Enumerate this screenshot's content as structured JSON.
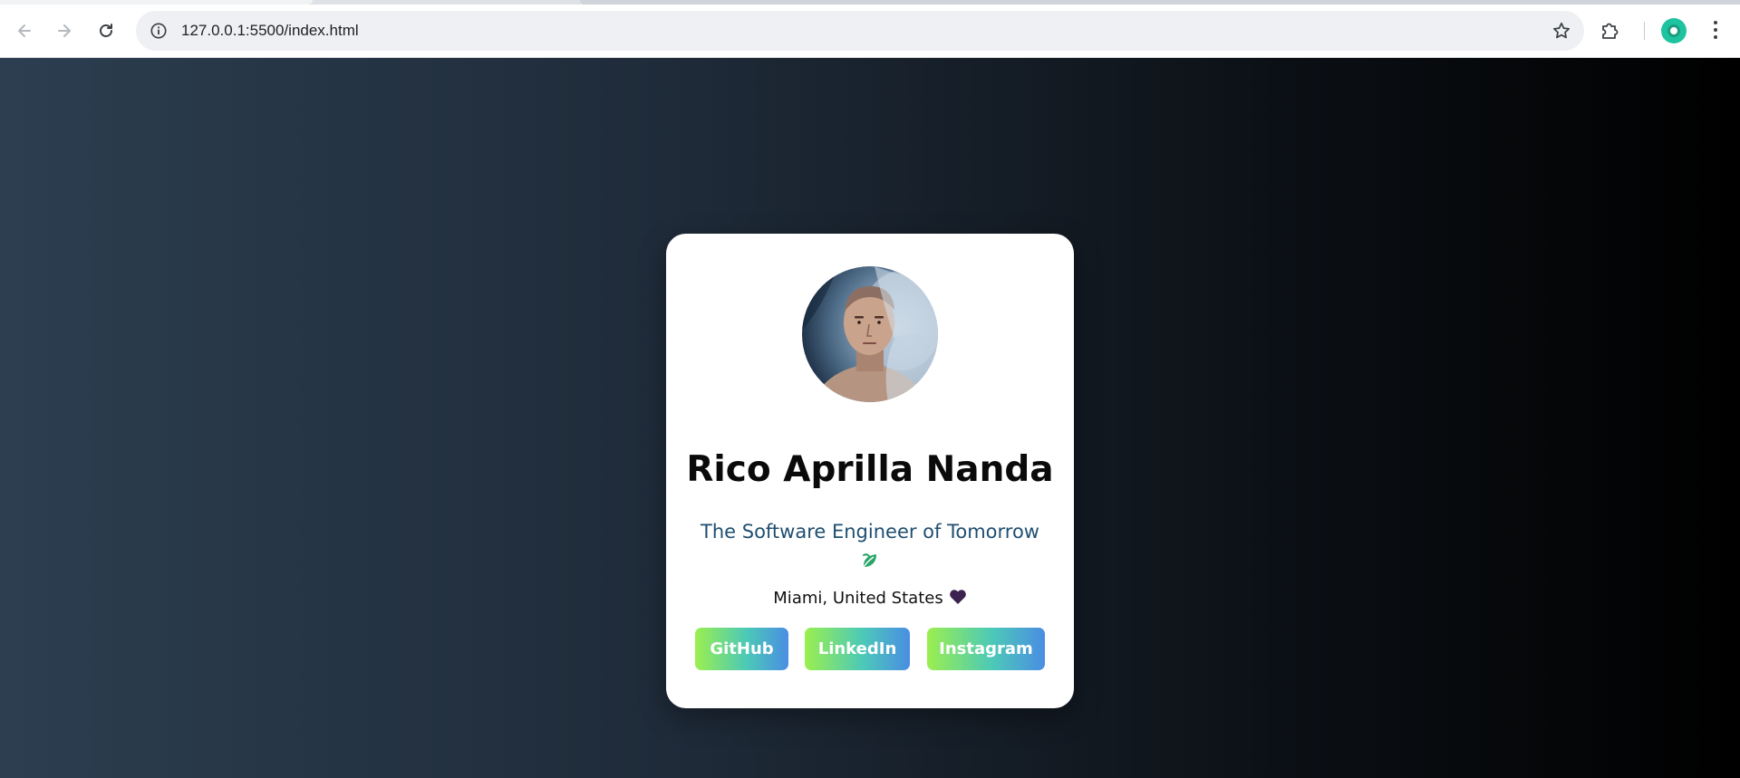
{
  "browser": {
    "url": "127.0.0.1:5500/index.html"
  },
  "icons": {
    "back": "arrow-left-icon",
    "forward": "arrow-right-icon",
    "reload": "reload-icon",
    "info": "info-icon",
    "bookmark": "star-icon",
    "extensions": "puzzle-icon",
    "profile": "profile-icon",
    "menu": "kebab-menu-icon"
  },
  "profile_card": {
    "name": "Rico Aprilla Nanda",
    "tagline": "The Software Engineer of Tomorrow",
    "location": "Miami, United States",
    "links": [
      {
        "label": "GitHub"
      },
      {
        "label": "LinkedIn"
      },
      {
        "label": "Instagram"
      }
    ]
  },
  "colors": {
    "background_start": "#2c3e50",
    "background_end": "#000000",
    "tagline": "#1f4e70",
    "button_gradient_start": "#9bef4f",
    "button_gradient_end": "#4a8ee3",
    "heart": "#3d2250",
    "leaf": "#2aa56a"
  }
}
